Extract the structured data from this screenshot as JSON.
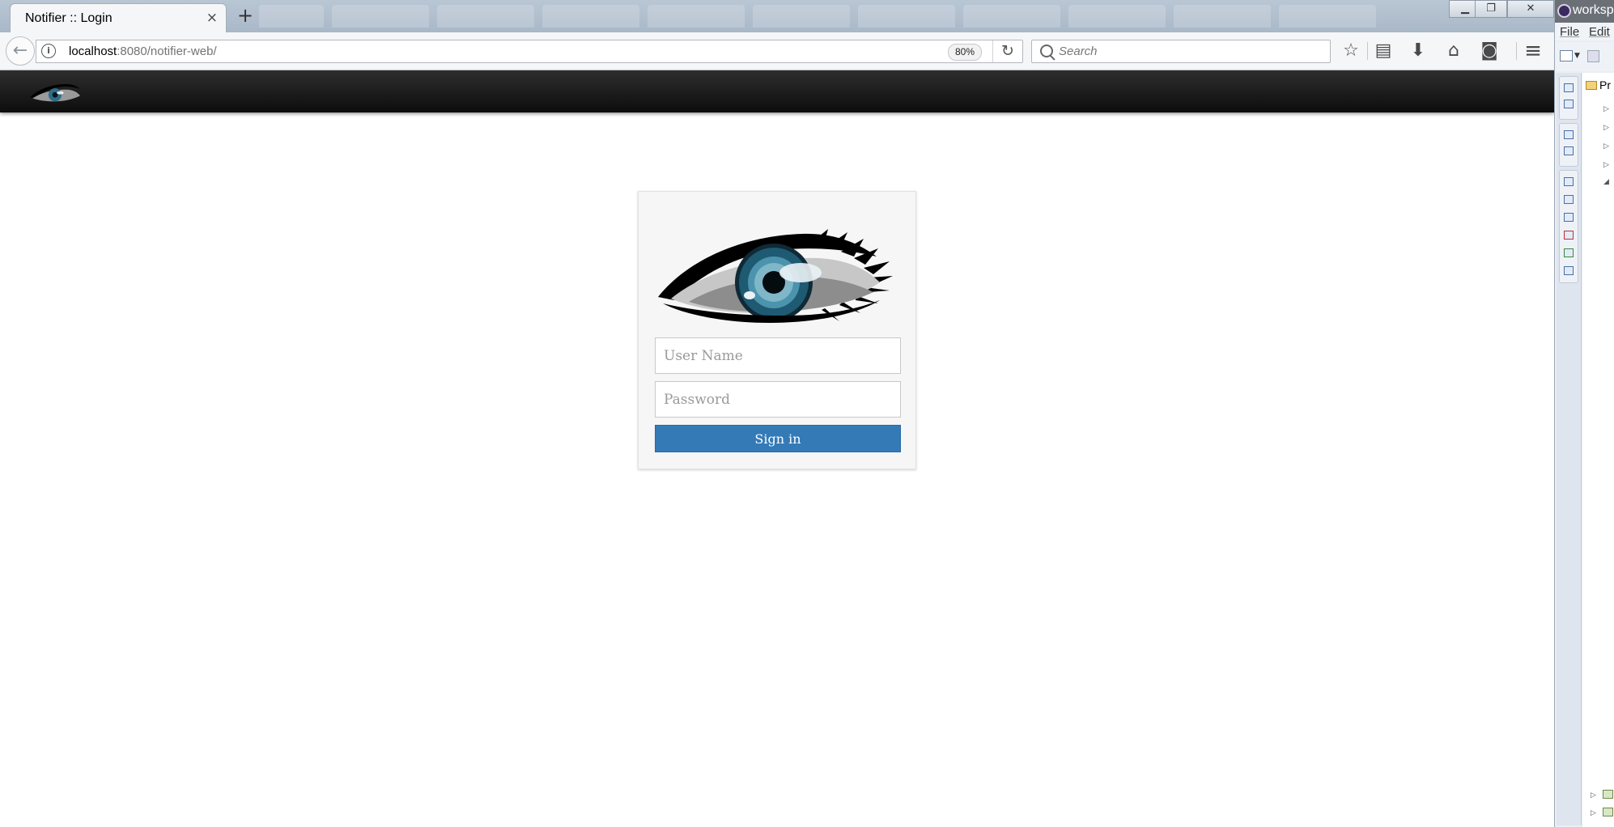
{
  "browser": {
    "tab": {
      "title": "Notifier :: Login",
      "close_glyph": "×"
    },
    "new_tab_glyph": "+",
    "window_controls": {
      "minimize": "▁",
      "maximize": "❐",
      "close": "✕"
    },
    "nav": {
      "back_glyph": "←",
      "info_glyph": "i",
      "url_host": "localhost",
      "url_rest": ":8080/notifier-web/",
      "zoom": "80%",
      "reload_glyph": "↻",
      "search_placeholder": "Search"
    },
    "toolbar_icons": [
      "star-icon",
      "reading-list-icon",
      "download-icon",
      "home-icon",
      "pocket-icon",
      "menu-icon"
    ],
    "toolbar_glyphs": {
      "bookmark": "☆",
      "library": "▤",
      "download": "⬇",
      "home": "⌂",
      "pocket": "◙",
      "menu": "≡"
    }
  },
  "login": {
    "username_placeholder": "User Name",
    "password_placeholder": "Password",
    "signin_label": "Sign in",
    "button_color": "#337ab7"
  },
  "eclipse": {
    "title": "worksp",
    "menu": [
      "File",
      "Edit"
    ],
    "project_explorer_label": "Pr"
  },
  "colors": {
    "header_bg": "#111111",
    "iris": "#2f6e88"
  }
}
